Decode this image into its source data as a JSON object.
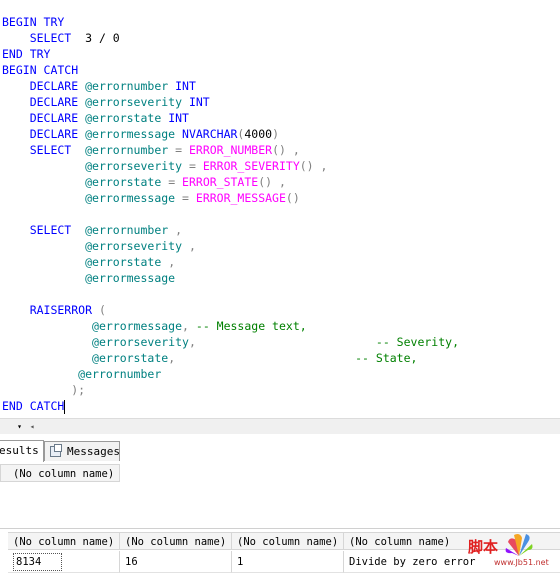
{
  "editor": {
    "lines": [
      [
        {
          "t": "BEGIN TRY",
          "c": "kw"
        }
      ],
      [
        {
          "t": "    SELECT ",
          "c": "kw"
        },
        {
          "t": " 3 / 0",
          "c": "tx"
        }
      ],
      [
        {
          "t": "END TRY",
          "c": "kw"
        }
      ],
      [
        {
          "t": "BEGIN CATCH",
          "c": "kw"
        }
      ],
      [
        {
          "t": "    DECLARE ",
          "c": "kw"
        },
        {
          "t": "@errornumber",
          "c": "var"
        },
        {
          "t": " INT",
          "c": "kw"
        }
      ],
      [
        {
          "t": "    DECLARE ",
          "c": "kw"
        },
        {
          "t": "@errorseverity",
          "c": "var"
        },
        {
          "t": " INT",
          "c": "kw"
        }
      ],
      [
        {
          "t": "    DECLARE ",
          "c": "kw"
        },
        {
          "t": "@errorstate",
          "c": "var"
        },
        {
          "t": " INT",
          "c": "kw"
        }
      ],
      [
        {
          "t": "    DECLARE ",
          "c": "kw"
        },
        {
          "t": "@errormessage",
          "c": "var"
        },
        {
          "t": " NVARCHAR",
          "c": "kw"
        },
        {
          "t": "(",
          "c": "op"
        },
        {
          "t": "4000",
          "c": "tx"
        },
        {
          "t": ")",
          "c": "op"
        }
      ],
      [
        {
          "t": "    SELECT  ",
          "c": "kw"
        },
        {
          "t": "@errornumber",
          "c": "var"
        },
        {
          "t": " = ",
          "c": "op"
        },
        {
          "t": "ERROR_NUMBER",
          "c": "fn"
        },
        {
          "t": "() ,",
          "c": "op"
        }
      ],
      [
        {
          "t": "            ",
          "c": "tx"
        },
        {
          "t": "@errorseverity",
          "c": "var"
        },
        {
          "t": " = ",
          "c": "op"
        },
        {
          "t": "ERROR_SEVERITY",
          "c": "fn"
        },
        {
          "t": "() ,",
          "c": "op"
        }
      ],
      [
        {
          "t": "            ",
          "c": "tx"
        },
        {
          "t": "@errorstate",
          "c": "var"
        },
        {
          "t": " = ",
          "c": "op"
        },
        {
          "t": "ERROR_STATE",
          "c": "fn"
        },
        {
          "t": "() ,",
          "c": "op"
        }
      ],
      [
        {
          "t": "            ",
          "c": "tx"
        },
        {
          "t": "@errormessage",
          "c": "var"
        },
        {
          "t": " = ",
          "c": "op"
        },
        {
          "t": "ERROR_MESSAGE",
          "c": "fn"
        },
        {
          "t": "()",
          "c": "op"
        }
      ],
      [],
      [
        {
          "t": "    SELECT  ",
          "c": "kw"
        },
        {
          "t": "@errornumber",
          "c": "var"
        },
        {
          "t": " ,",
          "c": "op"
        }
      ],
      [
        {
          "t": "            ",
          "c": "tx"
        },
        {
          "t": "@errorseverity",
          "c": "var"
        },
        {
          "t": " ,",
          "c": "op"
        }
      ],
      [
        {
          "t": "            ",
          "c": "tx"
        },
        {
          "t": "@errorstate",
          "c": "var"
        },
        {
          "t": " ,",
          "c": "op"
        }
      ],
      [
        {
          "t": "            ",
          "c": "tx"
        },
        {
          "t": "@errormessage",
          "c": "var"
        }
      ],
      [],
      [
        {
          "t": "    RAISERROR ",
          "c": "kw"
        },
        {
          "t": "(",
          "c": "op"
        }
      ],
      [
        {
          "t": "             ",
          "c": "tx"
        },
        {
          "t": "@errormessage",
          "c": "var"
        },
        {
          "t": ", ",
          "c": "op"
        },
        {
          "t": "-- Message text,",
          "c": "cm"
        }
      ],
      [
        {
          "t": "             ",
          "c": "tx"
        },
        {
          "t": "@errorseverity",
          "c": "var"
        },
        {
          "t": ",",
          "c": "op"
        },
        {
          "t": "                          -- Severity,",
          "c": "cm"
        }
      ],
      [
        {
          "t": "             ",
          "c": "tx"
        },
        {
          "t": "@errorstate",
          "c": "var"
        },
        {
          "t": ",",
          "c": "op"
        },
        {
          "t": "                          -- State,",
          "c": "cm"
        }
      ],
      [
        {
          "t": "           ",
          "c": "tx"
        },
        {
          "t": "@errornumber",
          "c": "var"
        }
      ],
      [
        {
          "t": "          );",
          "c": "op"
        }
      ],
      [
        {
          "t": "END CATCH",
          "c": "kw"
        }
      ]
    ]
  },
  "scroll": {
    "zoom_symbol": "▾",
    "left_arrow": "◂"
  },
  "tabs": {
    "results": "esults",
    "messages": "Messages"
  },
  "grid1": {
    "header": "(No column name)"
  },
  "grid2": {
    "headers": [
      "(No column name)",
      "(No column name)",
      "(No column name)",
      "(No column name)"
    ],
    "row": [
      "8134",
      "16",
      "1",
      "Divide by zero error"
    ]
  },
  "watermark": {
    "text": "脚本",
    "sub": "www.Jb51.net"
  }
}
